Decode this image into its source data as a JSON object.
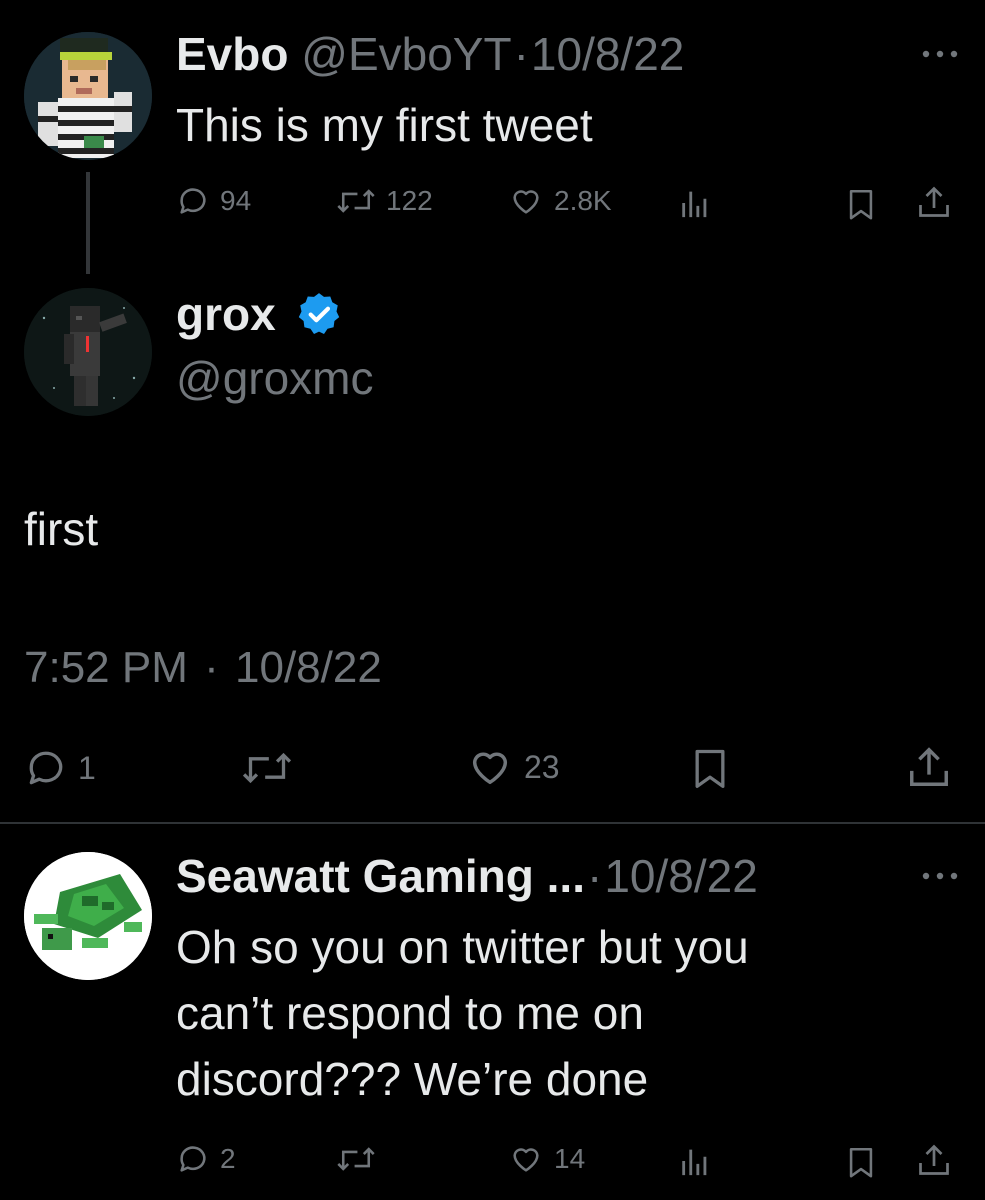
{
  "tweet1": {
    "display_name": "Evbo",
    "handle": "@EvboYT",
    "separator": "·",
    "date": "10/8/22",
    "text": "This is my first tweet",
    "replies": "94",
    "retweets": "122",
    "likes": "2.8K"
  },
  "tweet2": {
    "display_name": "grox",
    "handle": "@groxmc",
    "verified": true,
    "text": "first",
    "time": "7:52 PM",
    "separator": "·",
    "date": "10/8/22",
    "replies": "1",
    "likes": "23"
  },
  "tweet3": {
    "display_name": "Seawatt Gaming ...",
    "separator": "·",
    "date": "10/8/22",
    "text_lines": [
      "Oh so you on twitter but you",
      "can’t respond to me on",
      "discord??? We’re done"
    ],
    "replies": "2",
    "likes": "14"
  },
  "colors": {
    "background": "#000000",
    "text_primary": "#e7e9ea",
    "text_secondary": "#71767b",
    "verified_blue": "#1d9bf0",
    "divider": "#2f3336"
  },
  "icons": {
    "more": "ellipsis-icon",
    "reply": "speech-bubble-icon",
    "retweet": "retweet-arrows-icon",
    "like": "heart-outline-icon",
    "views": "bar-chart-icon",
    "bookmark": "bookmark-icon",
    "share": "share-upload-icon",
    "verified": "verified-badge-icon"
  }
}
